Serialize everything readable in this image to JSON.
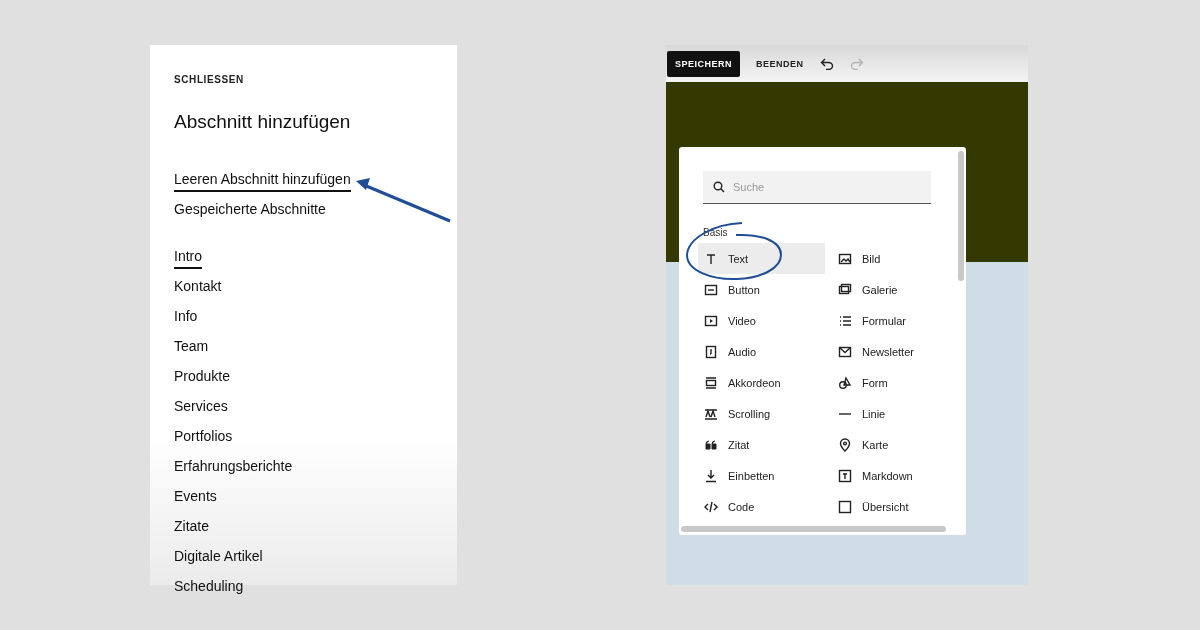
{
  "left_panel": {
    "close": "SCHLIESSEN",
    "title": "Abschnitt hinzufügen",
    "actions": [
      {
        "label": "Leeren Abschnitt hinzufügen",
        "underlined": true
      },
      {
        "label": "Gespeicherte Abschnitte",
        "underlined": false
      }
    ],
    "sections": [
      {
        "label": "Intro",
        "selected": true
      },
      {
        "label": "Kontakt",
        "selected": false
      },
      {
        "label": "Info",
        "selected": false
      },
      {
        "label": "Team",
        "selected": false
      },
      {
        "label": "Produkte",
        "selected": false
      },
      {
        "label": "Services",
        "selected": false
      },
      {
        "label": "Portfolios",
        "selected": false
      },
      {
        "label": "Erfahrungsberichte",
        "selected": false
      },
      {
        "label": "Events",
        "selected": false
      },
      {
        "label": "Zitate",
        "selected": false
      },
      {
        "label": "Digitale Artikel",
        "selected": false
      },
      {
        "label": "Scheduling",
        "selected": false
      }
    ]
  },
  "editor": {
    "toolbar": {
      "save": "SPEICHERN",
      "exit": "BEENDEN",
      "undo_enabled": true,
      "redo_enabled": false
    },
    "block_picker": {
      "search": {
        "placeholder": "Suche"
      },
      "group": "Basis",
      "blocks": [
        {
          "label": "Text",
          "selected": true
        },
        {
          "label": "Bild",
          "selected": false
        },
        {
          "label": "Button",
          "selected": false
        },
        {
          "label": "Galerie",
          "selected": false
        },
        {
          "label": "Video",
          "selected": false
        },
        {
          "label": "Formular",
          "selected": false
        },
        {
          "label": "Audio",
          "selected": false
        },
        {
          "label": "Newsletter",
          "selected": false
        },
        {
          "label": "Akkordeon",
          "selected": false
        },
        {
          "label": "Form",
          "selected": false
        },
        {
          "label": "Scrolling",
          "selected": false
        },
        {
          "label": "Linie",
          "selected": false
        },
        {
          "label": "Zitat",
          "selected": false
        },
        {
          "label": "Karte",
          "selected": false
        },
        {
          "label": "Einbetten",
          "selected": false
        },
        {
          "label": "Markdown",
          "selected": false
        },
        {
          "label": "Code",
          "selected": false
        },
        {
          "label": "Übersicht",
          "selected": false
        }
      ]
    }
  }
}
